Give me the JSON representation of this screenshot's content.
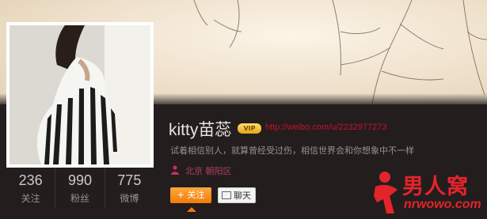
{
  "profile": {
    "name": "kitty苗蕊",
    "vip_label": "VIP",
    "url": "http://weibo.com/u/2232977273",
    "bio": "试着相信别人，就算曾经受过伤，相信世界会和你想象中不一样",
    "location": "北京 朝阳区"
  },
  "stats": [
    {
      "value": "236",
      "label": "关注"
    },
    {
      "value": "990",
      "label": "粉丝"
    },
    {
      "value": "775",
      "label": "微博"
    }
  ],
  "actions": {
    "follow_label": "+ 关注",
    "chat_label": "聊天"
  },
  "watermark": {
    "text": "男人窝",
    "url": "nrwowo.com"
  },
  "colors": {
    "accent_orange": "#f07a0a",
    "url_red": "#c8102e",
    "panel_bg": "#231d1d"
  }
}
